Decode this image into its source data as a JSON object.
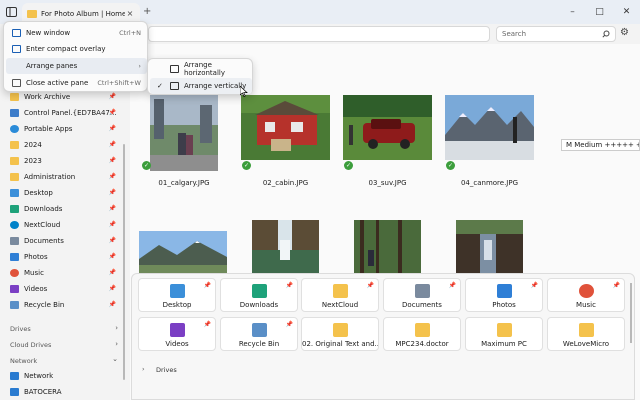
{
  "titlebar": {
    "tab_title": "For Photo Album | Home",
    "tab_close": "×",
    "new_tab": "+",
    "minimize": "–",
    "maximize": "□",
    "close": "✕"
  },
  "search": {
    "placeholder": "Search"
  },
  "menu": {
    "items": [
      {
        "label": "New window",
        "shortcut": "Ctrl+N"
      },
      {
        "label": "Enter compact overlay",
        "shortcut": ""
      },
      {
        "label": "Arrange panes",
        "shortcut": "›"
      },
      {
        "label": "Close active pane",
        "shortcut": "Ctrl+Shift+W"
      }
    ]
  },
  "submenu": {
    "items": [
      {
        "label": "Arrange horizontally",
        "checked": false
      },
      {
        "label": "Arrange vertically",
        "checked": true
      }
    ]
  },
  "sidebar": {
    "items": [
      {
        "label": "Work Archive",
        "color": "#f4c24c",
        "pinned": true
      },
      {
        "label": "Control Panel.{ED7BA47...",
        "color": "#3d7cc9",
        "pinned": true
      },
      {
        "label": "Portable Apps",
        "color": "#2a8bd8",
        "pinned": true
      },
      {
        "label": "2024",
        "color": "#f4c24c",
        "pinned": true
      },
      {
        "label": "2023",
        "color": "#f4c24c",
        "pinned": true
      },
      {
        "label": "Administration",
        "color": "#f4c24c",
        "pinned": true
      },
      {
        "label": "Desktop",
        "color": "#3b8fd9",
        "pinned": true
      },
      {
        "label": "Downloads",
        "color": "#1ea27a",
        "pinned": true
      },
      {
        "label": "NextCloud",
        "color": "#0082c9",
        "pinned": true
      },
      {
        "label": "Documents",
        "color": "#7a8a9e",
        "pinned": true
      },
      {
        "label": "Photos",
        "color": "#2f7fd6",
        "pinned": true
      },
      {
        "label": "Music",
        "color": "#e0523a",
        "pinned": true
      },
      {
        "label": "Videos",
        "color": "#7b3fc4",
        "pinned": true
      },
      {
        "label": "Recycle Bin",
        "color": "#5a8fc7",
        "pinned": true
      }
    ],
    "sections": [
      {
        "label": "Drives",
        "chevron": "›"
      },
      {
        "label": "Cloud Drives",
        "chevron": "›"
      },
      {
        "label": "Network",
        "chevron": "⌄"
      }
    ],
    "network_items": [
      {
        "label": "Network",
        "color": "#2a7bd0"
      },
      {
        "label": "BATOCERA",
        "color": "#2a7bd0"
      }
    ]
  },
  "photos": [
    {
      "name": "01_calgary.JPG",
      "synced": true
    },
    {
      "name": "02_cabin.JPG",
      "synced": true
    },
    {
      "name": "03_suv.JPG",
      "synced": true
    },
    {
      "name": "04_canmore.JPG",
      "synced": true
    }
  ],
  "tooltip": "M  Medium +++++ +",
  "quick_access": [
    {
      "label": "Desktop",
      "color": "#3b8fd9"
    },
    {
      "label": "Downloads",
      "color": "#1ea27a"
    },
    {
      "label": "NextCloud",
      "color": "#f4c24c"
    },
    {
      "label": "Documents",
      "color": "#7a8a9e"
    },
    {
      "label": "Photos",
      "color": "#2f7fd6"
    },
    {
      "label": "Music",
      "color": "#e0523a"
    },
    {
      "label": "Videos",
      "color": "#7b3fc4"
    },
    {
      "label": "Recycle Bin",
      "color": "#5a8fc7"
    },
    {
      "label": "02. Original Text and...",
      "color": "#f4c24c"
    },
    {
      "label": "MPC234.doctor",
      "color": "#f4c24c"
    },
    {
      "label": "Maximum PC",
      "color": "#f4c24c"
    },
    {
      "label": "WeLoveMicro",
      "color": "#f4c24c"
    }
  ],
  "drives_section": {
    "label": "Drives",
    "chevron": "›"
  }
}
